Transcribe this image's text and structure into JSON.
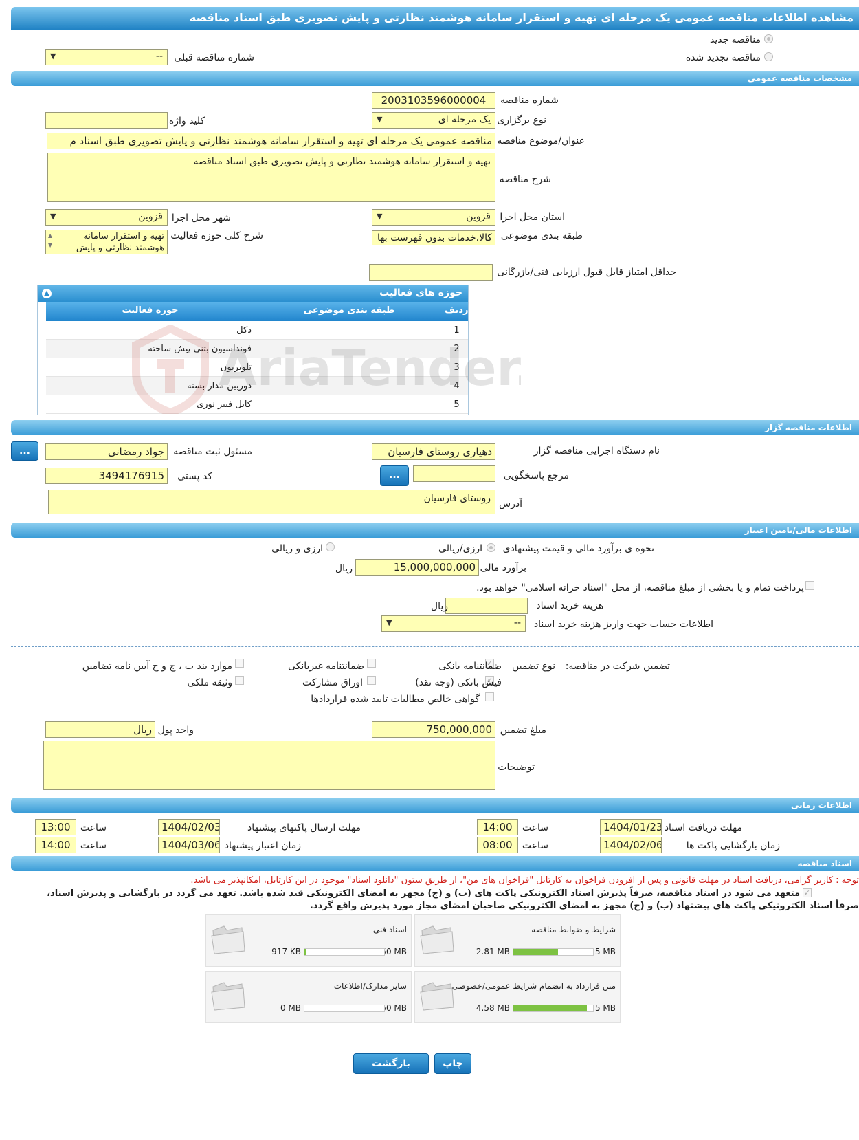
{
  "page_title": "مشاهده اطلاعات مناقصه عمومی یک مرحله ای تهیه و استقرار سامانه هوشمند نظارتی و پایش تصویری طبق اسناد مناقصه",
  "tender_type": {
    "new_label": "مناقصه جدید",
    "renewed_label": "مناقصه تجدید شده",
    "prev_number_label": "شماره مناقصه قبلی",
    "prev_number_value": "--"
  },
  "general": {
    "header": "مشخصات مناقصه عمومی",
    "number_label": "شماره مناقصه",
    "number_value": "2003103596000004",
    "holding_type_label": "نوع برگزاری",
    "holding_type_value": "یک مرحله ای",
    "keyword_label": "کلید واژه",
    "keyword_value": "",
    "subject_label": "عنوان/موضوع مناقصه",
    "subject_value": "مناقصه عمومی یک مرحله ای تهیه و استقرار سامانه هوشمند نظارتی و پایش تصویری  طبق اسناد م",
    "description_label": "شرح مناقصه",
    "description_value": "تهیه و استقرار سامانه هوشمند نظارتی و پایش تصویری  طبق اسناد مناقصه",
    "province_label": "استان محل اجرا",
    "province_value": "قزوین",
    "city_label": "شهر محل اجرا",
    "city_value": "قزوین",
    "category_label": "طبقه بندی موضوعی",
    "category_value": "کالا،خدمات بدون فهرست بها",
    "activity_desc_label": "شرح کلی حوزه فعالیت",
    "activity_desc_value": "تهیه و استقرار سامانه هوشمند نظارتی و پایش",
    "min_score_label": "حداقل امتیاز قابل قبول ارزیابی فنی/بازرگانی",
    "min_score_value": ""
  },
  "activity_grid": {
    "title": "حوزه های فعالیت",
    "headers": {
      "row": "ردیف",
      "category": "طبقه بندی موضوعی",
      "activity": "حوزه فعالیت"
    },
    "rows": [
      {
        "n": "1",
        "category": "",
        "activity": "دکل"
      },
      {
        "n": "2",
        "category": "",
        "activity": "فونداسیون بتنی پیش ساخته"
      },
      {
        "n": "3",
        "category": "",
        "activity": "تلویزیون"
      },
      {
        "n": "4",
        "category": "",
        "activity": "دوربین مدار بسته"
      },
      {
        "n": "5",
        "category": "",
        "activity": "کابل فیبر نوری"
      }
    ]
  },
  "organizer": {
    "header": "اطلاعات مناقصه گزار",
    "org_label": "نام دستگاه اجرایی مناقصه گزار",
    "org_value": "دهیاری روستای فارسیان",
    "responsible_label": "مسئول ثبت مناقصه",
    "responsible_value": "جواد رمضانی",
    "reference_label": "مرجع پاسخگویی",
    "reference_value": "",
    "postal_label": "کد پستی",
    "postal_value": "3494176915",
    "address_label": "آدرس",
    "address_value": "روستای فارسیان",
    "dots": "..."
  },
  "finance": {
    "header": "اطلاعات مالی/تامین اعتبار",
    "estimate_method_label": "نحوه ی برآورد مالی و قیمت پیشنهادی",
    "opt_rial": "ارزی/ریالی",
    "opt_fx": "ارزی و ریالی",
    "estimate_label": "برآورد مالی",
    "estimate_value": "15,000,000,000",
    "rial": "ریال",
    "treasury_note": "پرداخت تمام و یا بخشی از مبلغ مناقصه، از محل \"اسناد خزانه اسلامی\" خواهد بود.",
    "doc_fee_label": "هزینه خرید اسناد",
    "doc_fee_value": "",
    "account_label": "اطلاعات حساب جهت واریز هزینه خرید اسناد",
    "account_value": "--"
  },
  "guarantee": {
    "label": "تضمین شرکت در مناقصه:",
    "type_label": "نوع تضمین",
    "bank_guarantee": "ضمانتنامه بانکی",
    "nonbank_guarantee": "ضمانتنامه غیربانکی",
    "items_bcd": "موارد بند ب ، ج و خ آیین نامه تضامین",
    "bank_receipt": "فیش بانکی (وجه نقد)",
    "bonds": "اوراق مشارکت",
    "property": "وثیقه ملکی",
    "certificate": "گواهی خالص مطالبات تایید شده قراردادها",
    "amount_label": "مبلغ تضمین",
    "amount_value": "750,000,000",
    "currency_label": "واحد پول",
    "currency_value": "ریال",
    "notes_label": "توضیحات",
    "notes_value": ""
  },
  "timing": {
    "header": "اطلاعات زمانی",
    "doc_receive_label": "مهلت دریافت اسناد",
    "doc_receive_date": "1404/01/23",
    "doc_receive_time": "14:00",
    "send_label": "مهلت ارسال پاکتهای پیشنهاد",
    "send_date": "1404/02/03",
    "send_time": "13:00",
    "opening_label": "زمان بازگشایی پاکت ها",
    "opening_date": "1404/02/06",
    "opening_time": "08:00",
    "validity_label": "زمان اعتبار پیشنهاد",
    "validity_date": "1404/03/06",
    "validity_time": "14:00",
    "time_label": "ساعت"
  },
  "documents": {
    "header": "اسناد مناقصه",
    "notice": "توجه : کاربر گرامی، دریافت اسناد در مهلت قانونی و پس از افزودن فراخوان به کارتابل \"فراخوان های من\"، از طریق ستون \"دانلود اسناد\" موجود در این کارتابل، امکانپذیر می باشد.",
    "commitment_1": "متعهد می شود در اسناد مناقصه، صرفاً پذیرش اسناد الکترونیکی پاکت های (ب) و (ج) مجهز به امضای الکترونیکی قید شده باشد. تعهد می گردد در بازگشایی و پذیرش اسناد،",
    "commitment_2": "صرفاً اسناد الکترونیکی پاکت های پیشنهاد (ب) و (ج) مجهز به امضای الکترونیکی صاحبان امضای مجاز مورد پذیرش واقع گردد.",
    "cards": [
      {
        "title": "شرایط و ضوابط مناقصه",
        "max": "5 MB",
        "used": "2.81 MB",
        "fill": 0.56
      },
      {
        "title": "اسناد فنی",
        "max": "50 MB",
        "used": "917 KB",
        "fill": 0.02
      },
      {
        "title": "متن قرارداد به انضمام شرایط عمومی/خصوصی",
        "max": "5 MB",
        "used": "4.58 MB",
        "fill": 0.92
      },
      {
        "title": "سایر مدارک/اطلاعات",
        "max": "50 MB",
        "used": "0 MB",
        "fill": 0.0
      }
    ]
  },
  "buttons": {
    "print": "چاپ",
    "back": "بازگشت"
  },
  "watermark": "AriaTender.neT"
}
